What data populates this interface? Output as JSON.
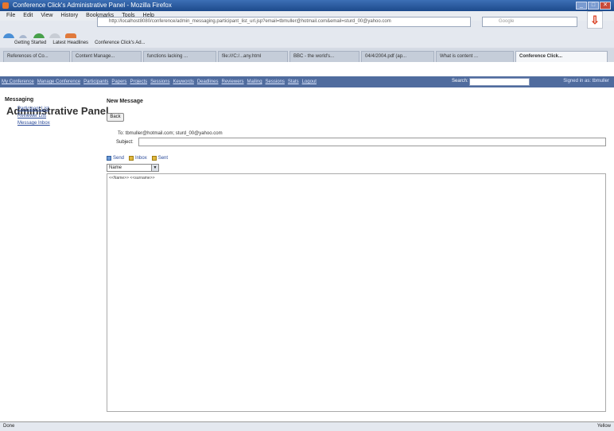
{
  "window": {
    "title": "Conference Click's Administrative Panel - Mozilla Firefox",
    "controls": [
      "minimize",
      "maximize",
      "close"
    ]
  },
  "menubar": [
    "File",
    "Edit",
    "View",
    "History",
    "Bookmarks",
    "Tools",
    "Help"
  ],
  "navigation": {
    "url": "http://localhost8080/conference/admin_messaging.participant_list_url.jsp?email=tbmuller@hotmail.com&email=sturd_00@yahoo.com",
    "search_placeholder": "Google"
  },
  "bookmarks": [
    "Getting Started",
    "Latest Headlines",
    "Conference Click's Ad..."
  ],
  "tabs": [
    {
      "label": "References of Co...",
      "active": false
    },
    {
      "label": "Content Manage...",
      "active": false
    },
    {
      "label": "functions lacking ...",
      "active": false
    },
    {
      "label": "file:///C:/...any.html",
      "active": false
    },
    {
      "label": "BBC - the world's...",
      "active": false
    },
    {
      "label": "04/4/2004.pdf (ap...",
      "active": false
    },
    {
      "label": "What is content ...",
      "active": false
    },
    {
      "label": "Conference Click...",
      "active": true
    }
  ],
  "page": {
    "title": "Administrative Panel"
  },
  "topnav": {
    "links": [
      "My Conference",
      "Manage Conference",
      "Participants",
      "Papers",
      "Projects",
      "Sessions",
      "Keywords",
      "Deadlines",
      "Reviewers",
      "Mailing",
      "Sessions",
      "Stats",
      "Logout"
    ],
    "search_label": "Search:",
    "right_text": "Signed in as: tbmuller"
  },
  "sidebar": {
    "heading": "Messaging",
    "items": [
      "Participant List",
      "Reviewer List",
      "Message Inbox"
    ]
  },
  "compose": {
    "heading": "New Message",
    "back_label": "Back",
    "to_line": "To: tbmuller@hotmail.com; sturd_00@yahoo.com",
    "subject_label": "Subject:",
    "subject_value": "",
    "toolbar": [
      "Send",
      "Inbox",
      "Sent"
    ],
    "font_select": "Name",
    "editor_text": "<<Name>> <<surname>>"
  },
  "status": {
    "left": "Done",
    "right": "Yellow"
  }
}
